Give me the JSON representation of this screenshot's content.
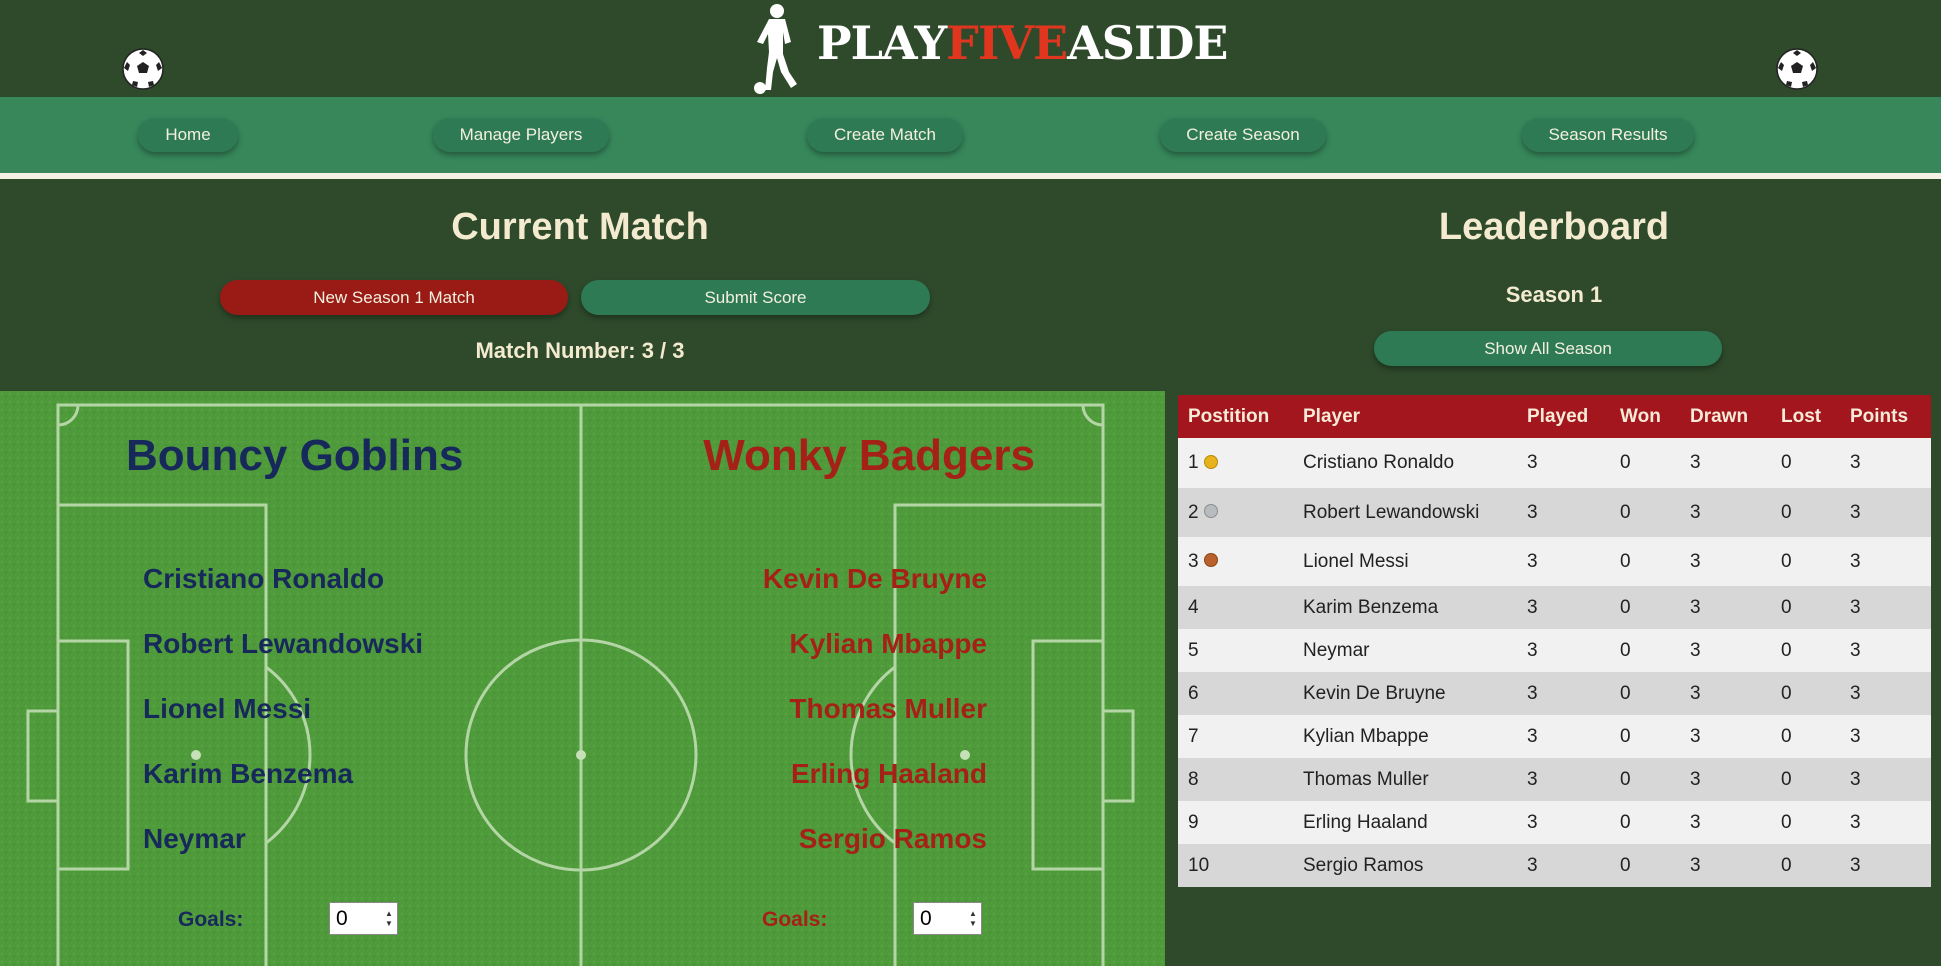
{
  "brand": {
    "part1": "PLAY",
    "part2": "FIVE",
    "part3": "ASIDE"
  },
  "nav": [
    {
      "label": "Home"
    },
    {
      "label": "Manage Players"
    },
    {
      "label": "Create Match"
    },
    {
      "label": "Create Season"
    },
    {
      "label": "Season Results"
    }
  ],
  "current_match": {
    "title": "Current Match",
    "new_match_label": "New Season 1 Match",
    "submit_label": "Submit Score",
    "match_number": "Match Number: 3 / 3"
  },
  "teams": {
    "home": {
      "name": "Bouncy Goblins",
      "players": [
        "Cristiano Ronaldo",
        "Robert Lewandowski",
        "Lionel Messi",
        "Karim Benzema",
        "Neymar"
      ],
      "goals_label": "Goals:",
      "goals": "0"
    },
    "away": {
      "name": "Wonky Badgers",
      "players": [
        "Kevin De Bruyne",
        "Kylian Mbappe",
        "Thomas Muller",
        "Erling Haaland",
        "Sergio Ramos"
      ],
      "goals_label": "Goals:",
      "goals": "0"
    }
  },
  "leaderboard": {
    "title": "Leaderboard",
    "season": "Season 1",
    "show_all_label": "Show All Season",
    "columns": [
      "Postition",
      "Player",
      "Played",
      "Won",
      "Drawn",
      "Lost",
      "Points"
    ],
    "rows": [
      {
        "pos": "1",
        "medal": "gold",
        "player": "Cristiano Ronaldo",
        "played": "3",
        "won": "0",
        "drawn": "3",
        "lost": "0",
        "points": "3"
      },
      {
        "pos": "2",
        "medal": "silver",
        "player": "Robert Lewandowski",
        "played": "3",
        "won": "0",
        "drawn": "3",
        "lost": "0",
        "points": "3"
      },
      {
        "pos": "3",
        "medal": "bronze",
        "player": "Lionel Messi",
        "played": "3",
        "won": "0",
        "drawn": "3",
        "lost": "0",
        "points": "3"
      },
      {
        "pos": "4",
        "medal": "",
        "player": "Karim Benzema",
        "played": "3",
        "won": "0",
        "drawn": "3",
        "lost": "0",
        "points": "3"
      },
      {
        "pos": "5",
        "medal": "",
        "player": "Neymar",
        "played": "3",
        "won": "0",
        "drawn": "3",
        "lost": "0",
        "points": "3"
      },
      {
        "pos": "6",
        "medal": "",
        "player": "Kevin De Bruyne",
        "played": "3",
        "won": "0",
        "drawn": "3",
        "lost": "0",
        "points": "3"
      },
      {
        "pos": "7",
        "medal": "",
        "player": "Kylian Mbappe",
        "played": "3",
        "won": "0",
        "drawn": "3",
        "lost": "0",
        "points": "3"
      },
      {
        "pos": "8",
        "medal": "",
        "player": "Thomas Muller",
        "played": "3",
        "won": "0",
        "drawn": "3",
        "lost": "0",
        "points": "3"
      },
      {
        "pos": "9",
        "medal": "",
        "player": "Erling Haaland",
        "played": "3",
        "won": "0",
        "drawn": "3",
        "lost": "0",
        "points": "3"
      },
      {
        "pos": "10",
        "medal": "",
        "player": "Sergio Ramos",
        "played": "3",
        "won": "0",
        "drawn": "3",
        "lost": "0",
        "points": "3"
      }
    ]
  },
  "colors": {
    "background": "#2e4a2b",
    "nav": "#37875b",
    "accent_red": "#9a1b16",
    "accent_green": "#2e7a55",
    "home_team": "#17285a",
    "away_team": "#a52118",
    "table_header": "#a3161d"
  },
  "icons": [
    "soccer-ball-icon",
    "player-silhouette-logo",
    "medal-gold-icon",
    "medal-silver-icon",
    "medal-bronze-icon"
  ]
}
